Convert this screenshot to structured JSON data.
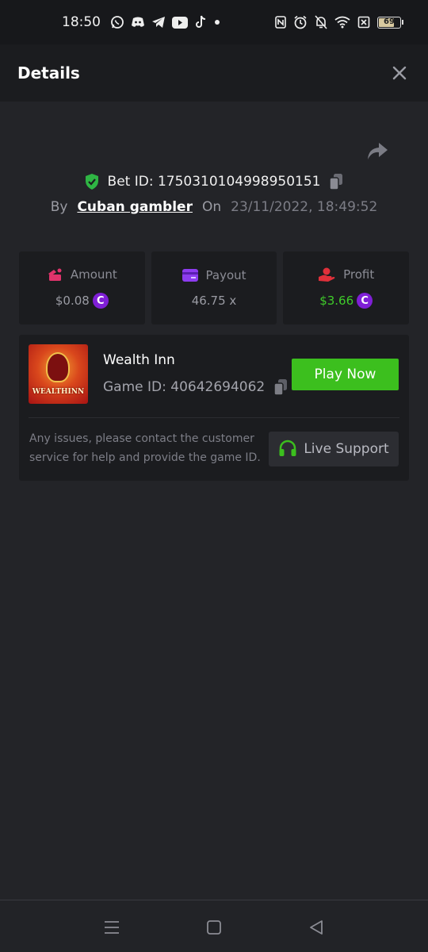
{
  "status_bar": {
    "time": "18:50",
    "battery": "69",
    "notification_icons": [
      "whatsapp-icon",
      "discord-icon",
      "telegram-icon",
      "youtube-icon",
      "tiktok-icon",
      "dot-icon"
    ],
    "system_icons": [
      "nfc-icon",
      "alarm-icon",
      "bell-off-icon",
      "wifi-icon",
      "sim-off-icon",
      "battery-icon"
    ]
  },
  "header": {
    "title": "Details",
    "close_icon": "close-icon"
  },
  "bet": {
    "bet_id_label": "Bet ID: 1750310104998950151",
    "by_label": "By",
    "user": "Cuban gambler",
    "on_label": "On",
    "date": "23/11/2022, 18:49:52"
  },
  "stats": [
    {
      "label": "Amount",
      "value": "$0.08",
      "icon": "amount-icon",
      "coin": "C"
    },
    {
      "label": "Payout",
      "value": "46.75 x",
      "icon": "payout-card-icon"
    },
    {
      "label": "Profit",
      "value": "$3.66",
      "icon": "profit-hand-icon",
      "coin": "C"
    }
  ],
  "game": {
    "name": "Wealth Inn",
    "game_id_label": "Game ID: 40642694062",
    "thumbnail_text": "WEALTHINN",
    "play_label": "Play Now",
    "help_text": "Any issues, please contact the customer service for help and provide the game ID.",
    "support_label": "Live Support"
  },
  "colors": {
    "background": "#232428",
    "panel": "#1b1c1f",
    "accent_green": "#3cbf1e",
    "profit_green": "#3fcb2a",
    "coin_purple": "#7f1fd6",
    "amount_pink": "#e0336b",
    "payout_purple": "#8d3cf0",
    "profit_red": "#e0303a"
  }
}
